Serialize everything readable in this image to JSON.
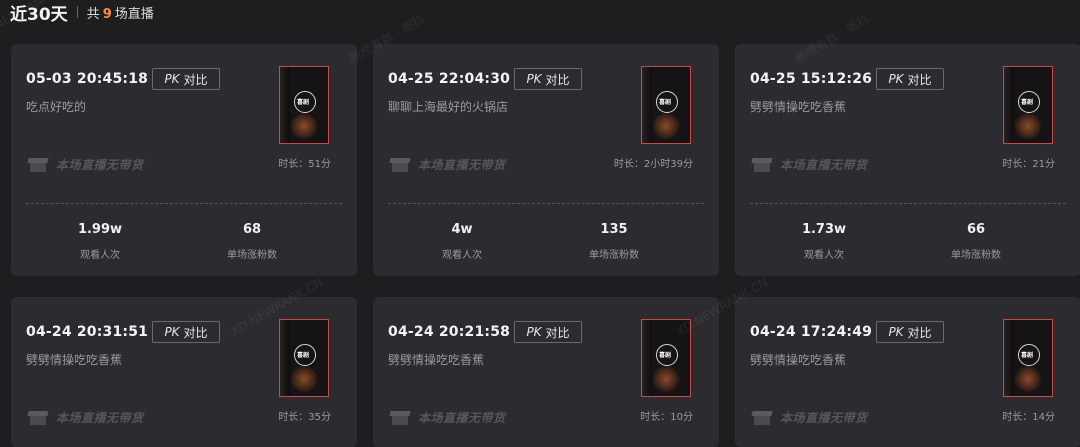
{
  "header": {
    "period": "近30天",
    "count_prefix": "共",
    "count": "9",
    "count_suffix": "场直播"
  },
  "common": {
    "pk_mark": "PK",
    "pk_label": "对比",
    "no_goods_label": "本场直播无带货",
    "views_label": "观看人次",
    "fans_label": "单场涨粉数",
    "thumb_logo": "喜剧"
  },
  "watermarks": [
    "新榜有数 · 新科",
    "新榜有数 · 新科",
    "XD.NEWRANK.CN",
    "XD.NEWRANK.CN",
    "XD.NEWRANK.CN"
  ],
  "cards": [
    {
      "time": "05-03 20:45:18",
      "title": "吃点好吃的",
      "duration": "时长：51分",
      "views": "1.99w",
      "fans": "68"
    },
    {
      "time": "04-25 22:04:30",
      "title": "聊聊上海最好的火锅店",
      "duration": "时长：2小时39分",
      "views": "4w",
      "fans": "135"
    },
    {
      "time": "04-25 15:12:26",
      "title": "劈劈情操吃吃香蕉",
      "duration": "时长：21分",
      "views": "1.73w",
      "fans": "66"
    },
    {
      "time": "04-24 20:31:51",
      "title": "劈劈情操吃吃香蕉",
      "duration": "时长：35分"
    },
    {
      "time": "04-24 20:21:58",
      "title": "劈劈情操吃吃香蕉",
      "duration": "时长：10分"
    },
    {
      "time": "04-24 17:24:49",
      "title": "劈劈情操吃吃香蕉",
      "duration": "时长：14分"
    }
  ]
}
